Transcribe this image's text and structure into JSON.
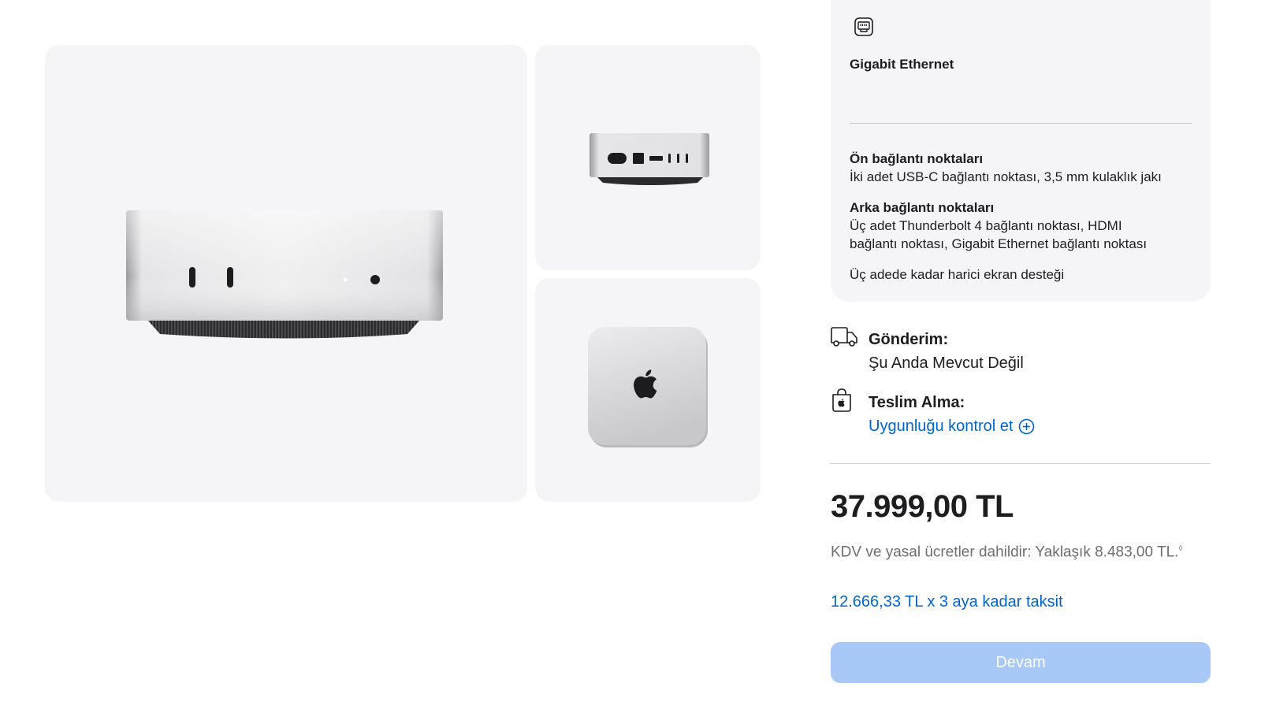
{
  "spec_card": {
    "ethernet_label": "Gigabit Ethernet",
    "front_ports_title": "Ön bağlantı noktaları",
    "front_ports_text": "İki adet USB-C bağlantı noktası, 3,5 mm kulaklık jakı",
    "back_ports_title": "Arka bağlantı noktaları",
    "back_ports_line1": "Üç adet Thunderbolt 4 bağlantı noktası, HDMI",
    "back_ports_line2": "bağlantı noktası, Gigabit Ethernet bağlantı noktası",
    "display_support": "Üç adede kadar harici ekran desteği"
  },
  "delivery": {
    "shipping_label": "Gönderim:",
    "shipping_value": "Şu Anda Mevcut Değil",
    "pickup_label": "Teslim Alma:",
    "pickup_link": "Uygunluğu kontrol et"
  },
  "pricing": {
    "price": "37.999,00 TL",
    "tax_note": "KDV ve yasal ücretler dahildir: Yaklaşık 8.483,00 TL.",
    "tax_marker": "◊",
    "installment": "12.666,33 TL x 3 aya kadar taksit"
  },
  "actions": {
    "continue_label": "Devam"
  },
  "gallery": {
    "images": [
      "mac-mini-front-view",
      "mac-mini-back-view",
      "mac-mini-top-view"
    ]
  },
  "icons": {
    "ethernet": "ethernet-port-icon",
    "shipping": "delivery-truck-icon",
    "pickup": "shopping-bag-icon",
    "expand": "plus-circle-icon"
  },
  "colors": {
    "link": "#0066cc",
    "button_disabled": "#a8c8f7",
    "card_background": "#f5f5f7",
    "text_primary": "#1d1d1f",
    "text_secondary": "#6e6e73"
  }
}
